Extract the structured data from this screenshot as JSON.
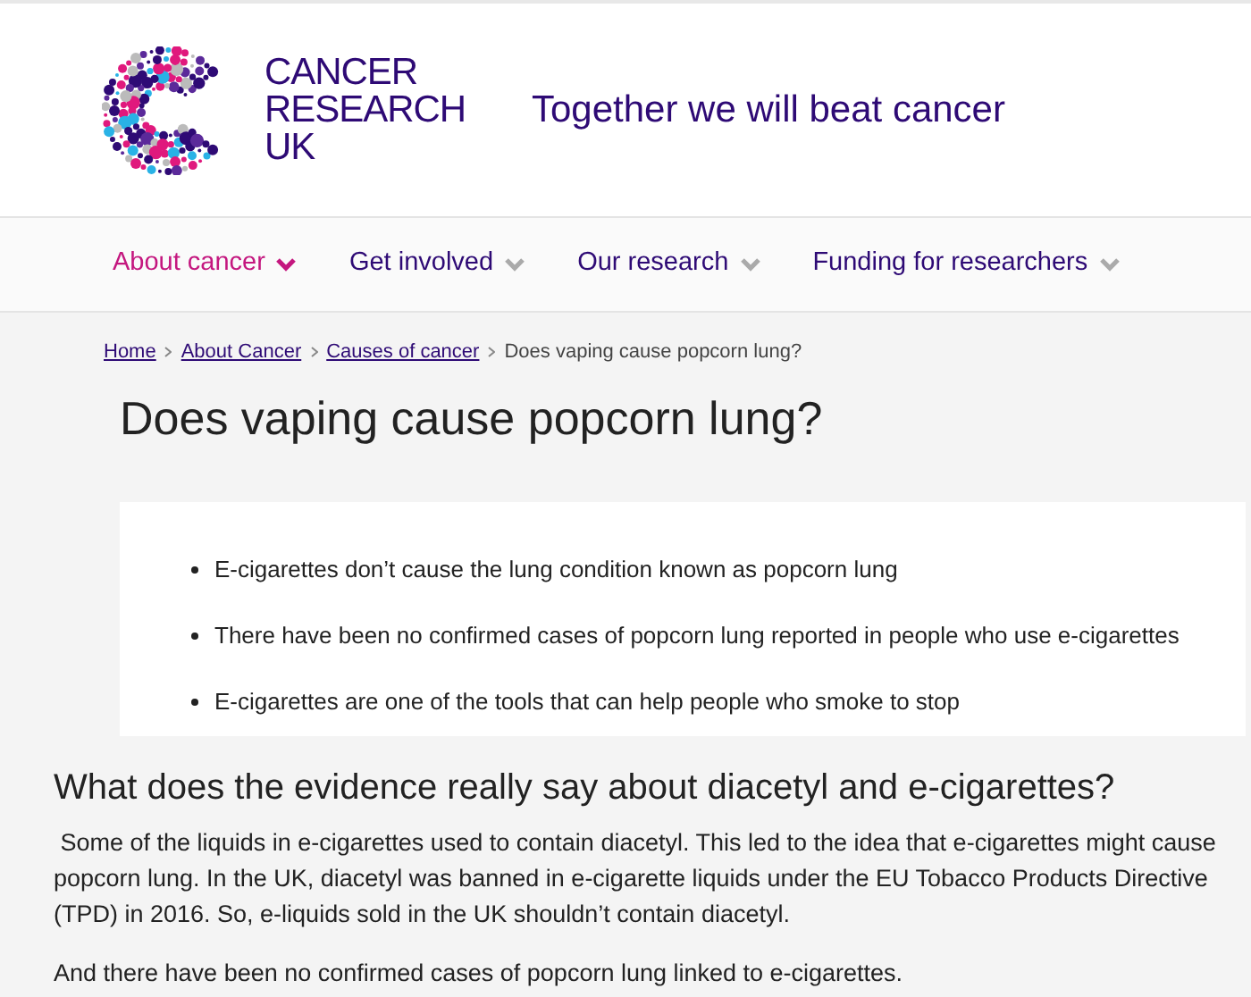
{
  "logo": {
    "lines": [
      "CANCER",
      "RESEARCH",
      "UK"
    ]
  },
  "tagline": "Together we will beat cancer",
  "nav": [
    {
      "label": "About cancer",
      "selected": true
    },
    {
      "label": "Get involved",
      "selected": false
    },
    {
      "label": "Our research",
      "selected": false
    },
    {
      "label": "Funding for researchers",
      "selected": false
    }
  ],
  "breadcrumb": {
    "links": [
      "Home",
      "About Cancer",
      "Causes of cancer"
    ],
    "current": "Does vaping cause popcorn lung?"
  },
  "title": "Does vaping cause popcorn lung?",
  "summary": [
    "E-cigarettes don’t cause the lung condition known as popcorn lung",
    "There have been no confirmed cases of popcorn lung reported in people who use e-cigarettes",
    "E-cigarettes are one of the tools that can help people who smoke to stop"
  ],
  "section_heading": "What does the evidence really say about diacetyl and e-cigarettes?",
  "paragraphs": [
    " Some of the liquids in e-cigarettes used to contain diacetyl. This led to the idea that e-cigarettes might cause popcorn lung. In the UK, diacetyl was banned in e-cigarette liquids under the EU Tobacco Products Directive (TPD) in 2016. So, e-liquids sold in the UK shouldn’t contain diacetyl.",
    "And there have been no confirmed cases of popcorn lung linked to e-cigarettes."
  ]
}
